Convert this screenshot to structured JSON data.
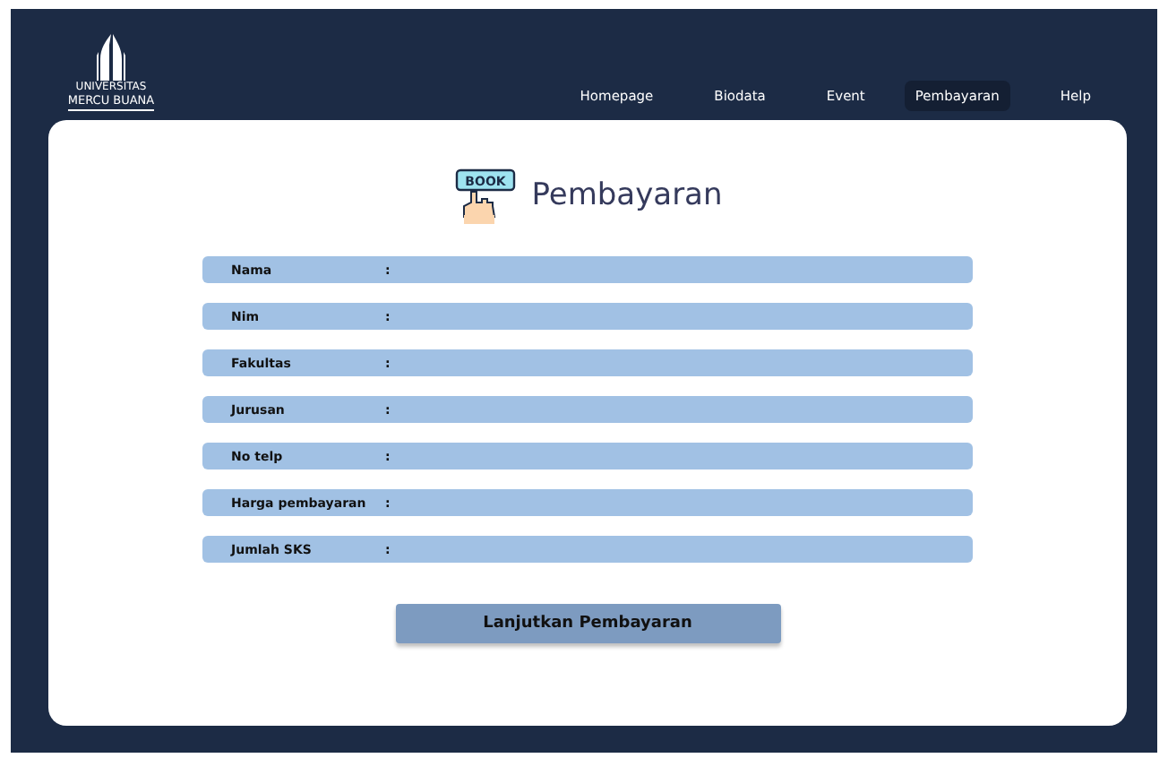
{
  "logo": {
    "top": "UNIVERSITAS",
    "name": "MERCU BUANA"
  },
  "nav": [
    {
      "label": "Homepage",
      "selected": false
    },
    {
      "label": "Biodata",
      "selected": false
    },
    {
      "label": "Event",
      "selected": false
    },
    {
      "label": "Pembayaran",
      "selected": true
    },
    {
      "label": "Help",
      "selected": false
    }
  ],
  "page": {
    "icon_text": "BOOK",
    "title": "Pembayaran"
  },
  "fields": [
    {
      "label": "Nama",
      "separator": ":"
    },
    {
      "label": "Nim",
      "separator": ":"
    },
    {
      "label": "Fakultas",
      "separator": ":"
    },
    {
      "label": "Jurusan",
      "separator": ":"
    },
    {
      "label": "No telp",
      "separator": ":"
    },
    {
      "label": "Harga pembayaran",
      "separator": ":"
    },
    {
      "label": "Jumlah SKS",
      "separator": ":"
    }
  ],
  "button": "Lanjutkan Pembayaran"
}
